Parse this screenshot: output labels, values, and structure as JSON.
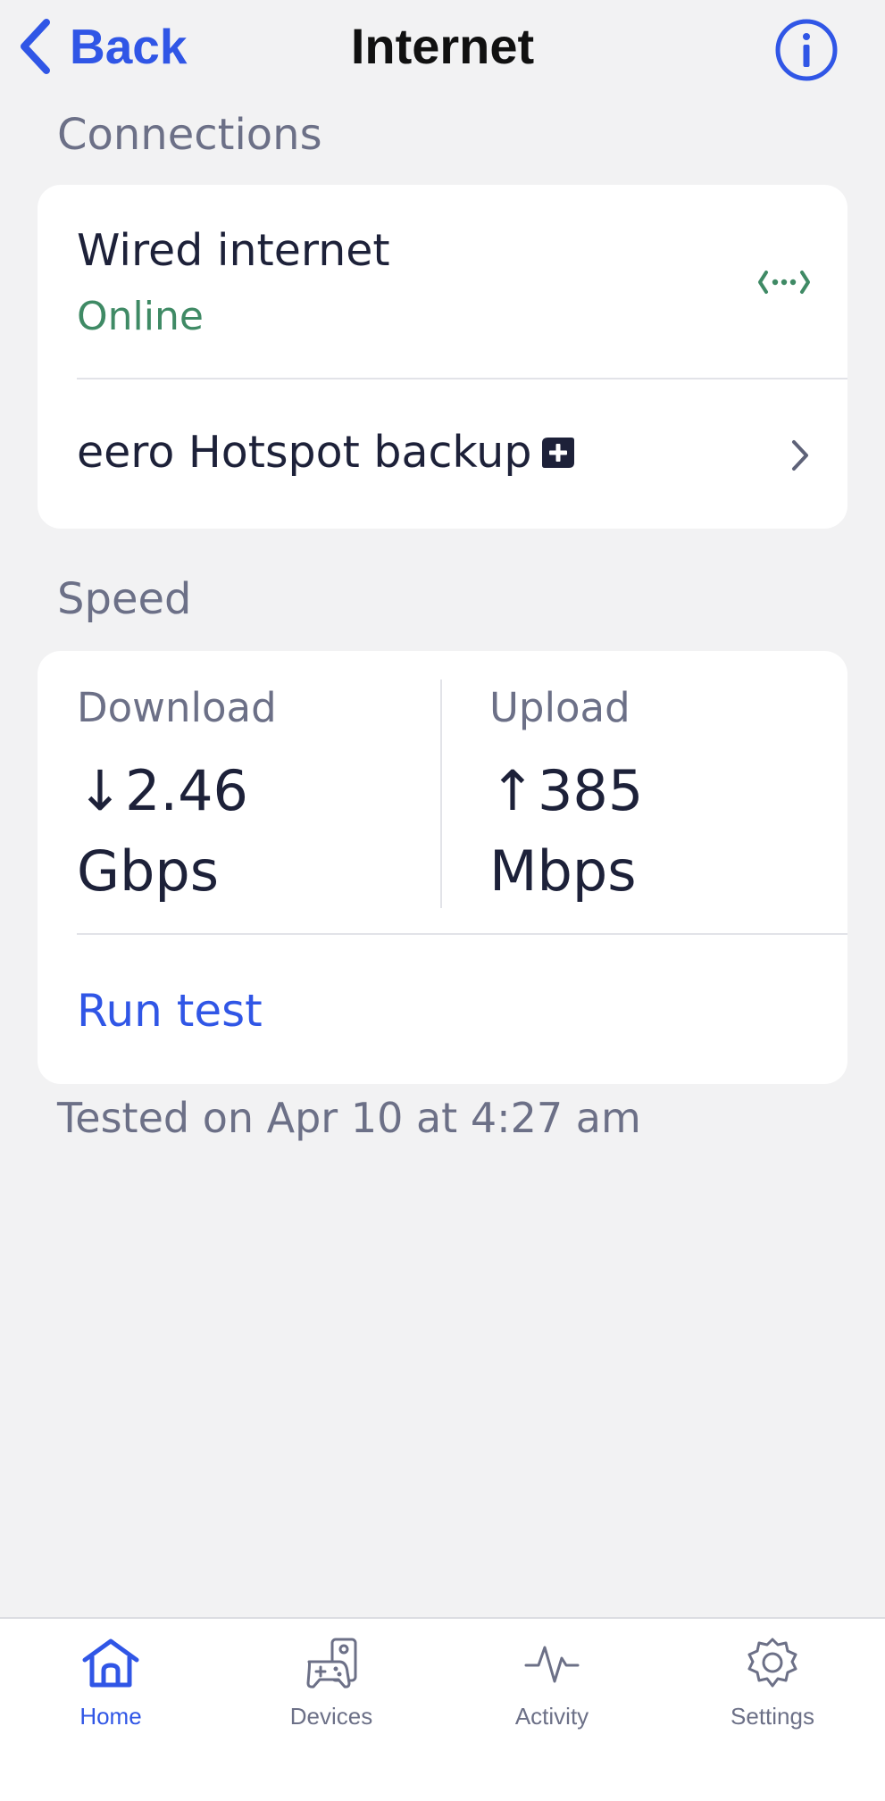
{
  "header": {
    "back_label": "Back",
    "title": "Internet",
    "info_icon": "info-icon"
  },
  "connections": {
    "heading": "Connections",
    "wired": {
      "title": "Wired internet",
      "status": "Online",
      "icon": "ethernet-icon"
    },
    "hotspot": {
      "title": "eero Hotspot backup",
      "badge_icon": "eero-plus-icon",
      "chevron_icon": "chevron-right-icon"
    }
  },
  "speed": {
    "heading": "Speed",
    "download": {
      "label": "Download",
      "arrow": "↓",
      "value": "2.46",
      "unit": "Gbps"
    },
    "upload": {
      "label": "Upload",
      "arrow": "↑",
      "value": "385",
      "unit": "Mbps"
    },
    "run_test_label": "Run test",
    "tested_text": "Tested on Apr 10 at 4:27 am"
  },
  "tabs": [
    {
      "label": "Home",
      "icon": "home-icon",
      "active": true
    },
    {
      "label": "Devices",
      "icon": "devices-icon",
      "active": false
    },
    {
      "label": "Activity",
      "icon": "activity-icon",
      "active": false
    },
    {
      "label": "Settings",
      "icon": "settings-icon",
      "active": false
    }
  ],
  "colors": {
    "accent": "#3056e6",
    "online": "#3f8a65",
    "muted_text": "#6c7087",
    "primary_text": "#1d2139",
    "background": "#f2f2f3"
  }
}
